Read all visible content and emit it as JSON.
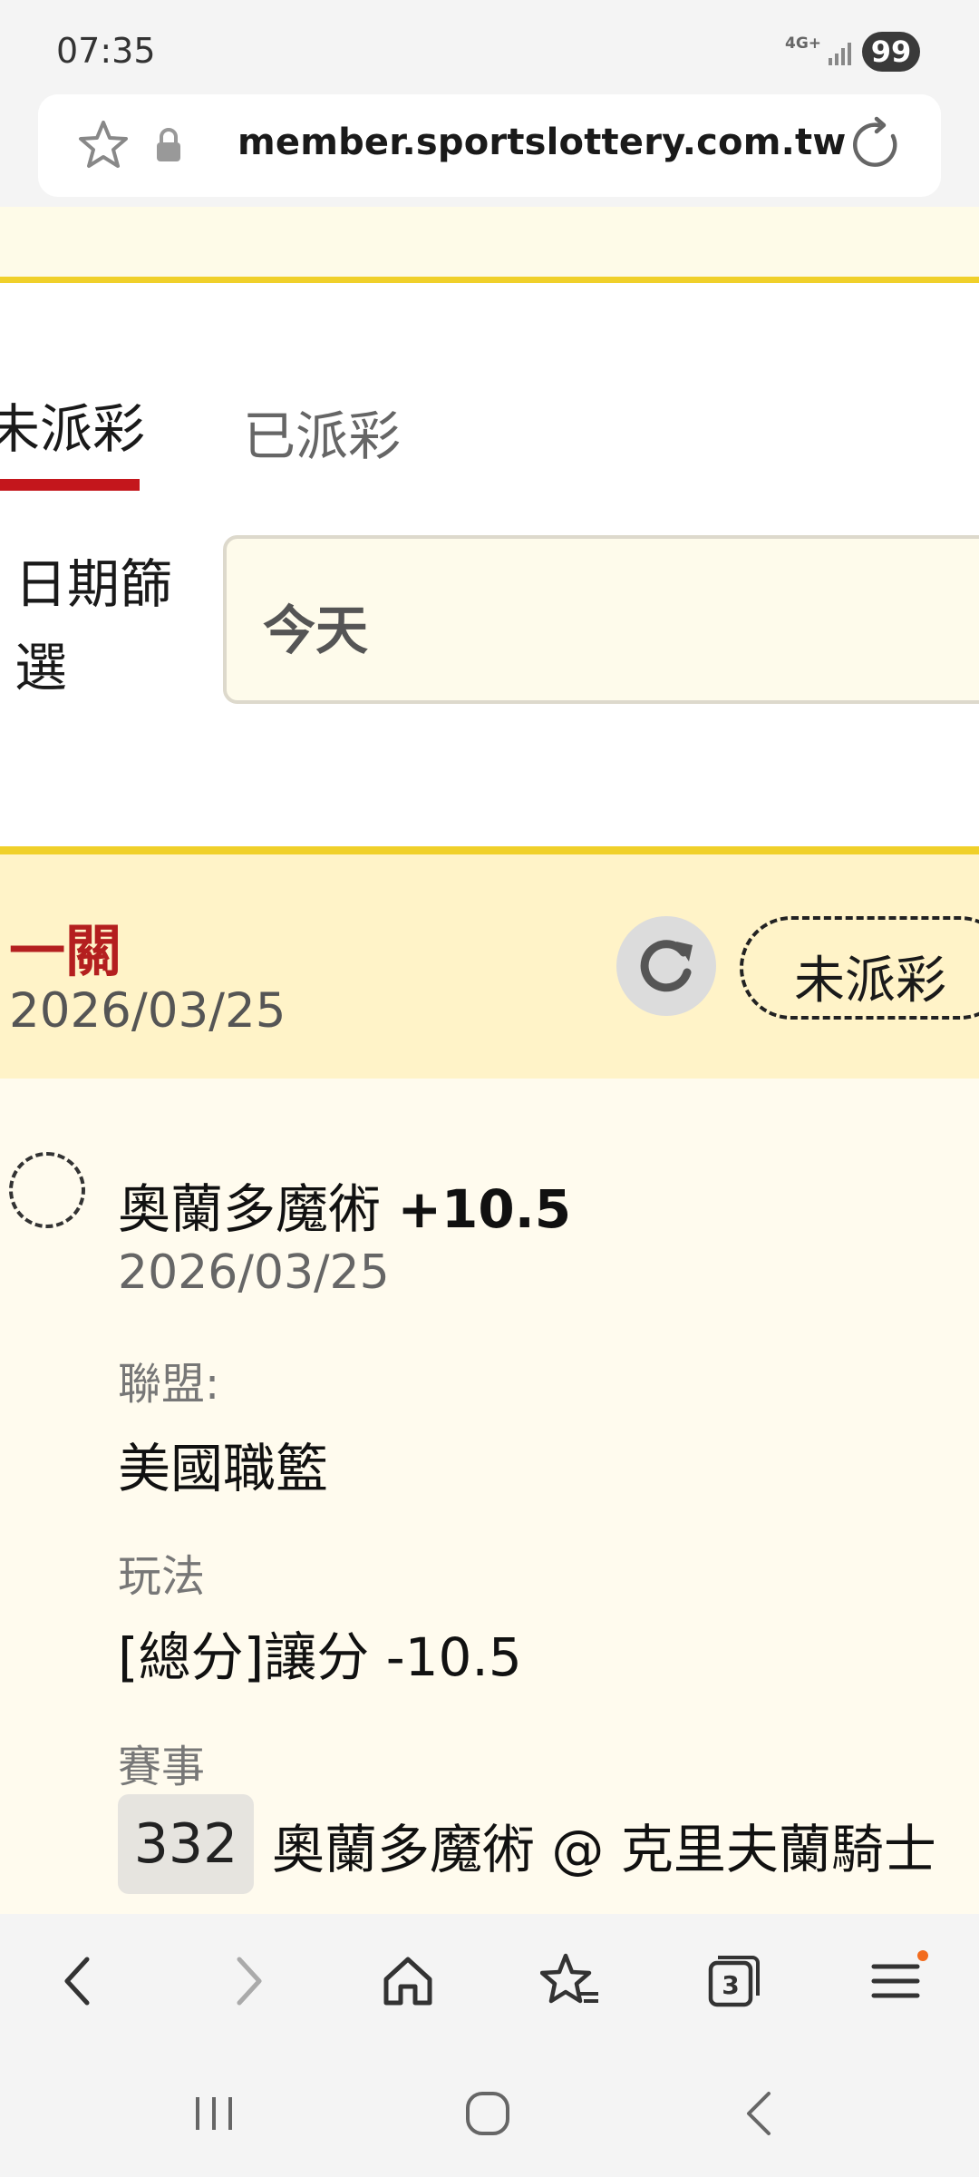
{
  "status_bar": {
    "time": "07:35",
    "network": "4G+",
    "battery": "99"
  },
  "browser": {
    "url": "member.sportslottery.com.tw",
    "tabs_count": "3"
  },
  "tabs": [
    {
      "label": "未派彩",
      "active": true
    },
    {
      "label": "已派彩",
      "active": false
    }
  ],
  "filter": {
    "label": "日期篩選",
    "value": "今天"
  },
  "bet_card": {
    "title": "一關",
    "date": "2026/03/25",
    "status": "未派彩",
    "selection": {
      "team": "奧蘭多魔術",
      "line": "+10.5",
      "date": "2026/03/25",
      "league_label": "聯盟:",
      "league": "美國職籃",
      "play_label": "玩法",
      "play": "[總分]讓分 -10.5",
      "event_label": "賽事",
      "event_number": "332",
      "event_name": "奧蘭多魔術 @ 克里夫蘭騎士"
    }
  },
  "colors": {
    "accent_red": "#c4161c",
    "accent_yellow": "#f0d02a",
    "card_header_bg": "#fff3c8"
  },
  "icons": [
    "star-icon",
    "lock-icon",
    "reload-icon",
    "refresh-icon",
    "back-icon",
    "forward-icon",
    "home-icon",
    "bookmarks-icon",
    "tabs-icon",
    "menu-icon",
    "recents-icon",
    "home-nav-icon",
    "back-nav-icon"
  ]
}
